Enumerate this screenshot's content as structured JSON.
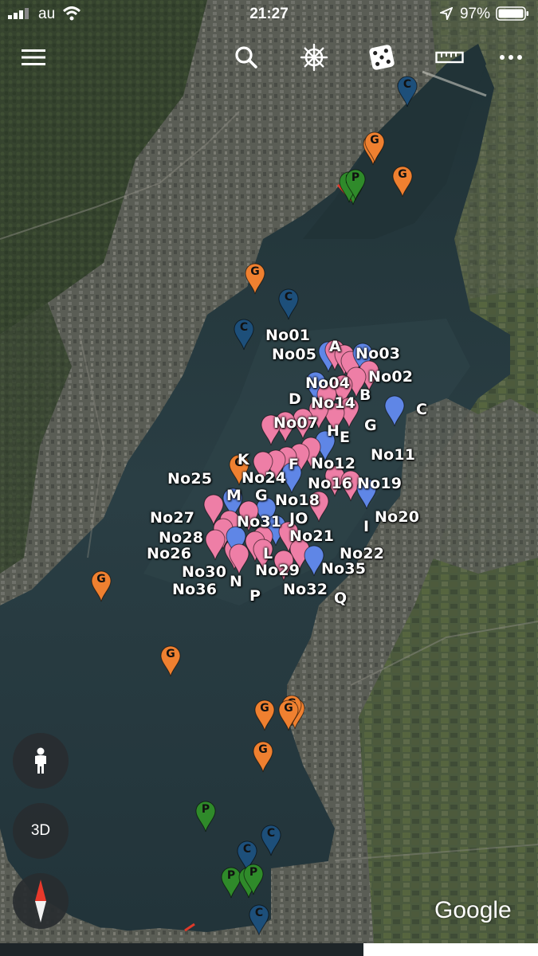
{
  "status_bar": {
    "carrier": "au",
    "time": "21:27",
    "battery": "97%"
  },
  "toolbar": {
    "menu_icon": "hamburger-menu-icon",
    "search_icon": "search-icon",
    "voyager_icon": "ship-wheel-icon",
    "feeling_lucky_icon": "dice-icon",
    "measure_icon": "ruler-icon",
    "more_icon": "more-dots-icon"
  },
  "controls": {
    "pegman_icon": "pegman-icon",
    "view_3d_label": "3D",
    "compass_icon": "compass-icon"
  },
  "brand": {
    "logo_text": "Google"
  },
  "colors": {
    "pin_orange": "#ef8030",
    "pin_blue_dark": "#1d4f7a",
    "pin_green": "#2f8a2a",
    "pin_pink": "#ee7ea6",
    "pin_light_blue": "#5f86e6",
    "water": "#26393f",
    "land": "#4a5140"
  },
  "labels": {
    "no01": "No01",
    "no02": "No02",
    "no03": "No03",
    "no04": "No04",
    "no05": "No05",
    "no07": "No07",
    "no11": "No11",
    "no12": "No12",
    "no14": "No14",
    "no16": "No16",
    "no18": "No18",
    "no19": "No19",
    "no20": "No20",
    "no21": "No21",
    "no22": "No22",
    "no24": "No24",
    "no25": "No25",
    "no26": "No26",
    "no27": "No27",
    "no28": "No28",
    "no29": "No29",
    "no30": "No30",
    "no31": "No31",
    "no32": "No32",
    "no35": "No35",
    "no36": "No36",
    "a": "A",
    "b": "B",
    "c": "C",
    "d": "D",
    "e": "E",
    "f": "F",
    "g": "G",
    "h": "H",
    "i": "I",
    "jo": "JO",
    "k": "K",
    "l": "L",
    "m": "M",
    "n": "N",
    "p": "P",
    "q": "Q"
  },
  "pin_letters": {
    "g": "G",
    "c": "C",
    "p": "P"
  }
}
